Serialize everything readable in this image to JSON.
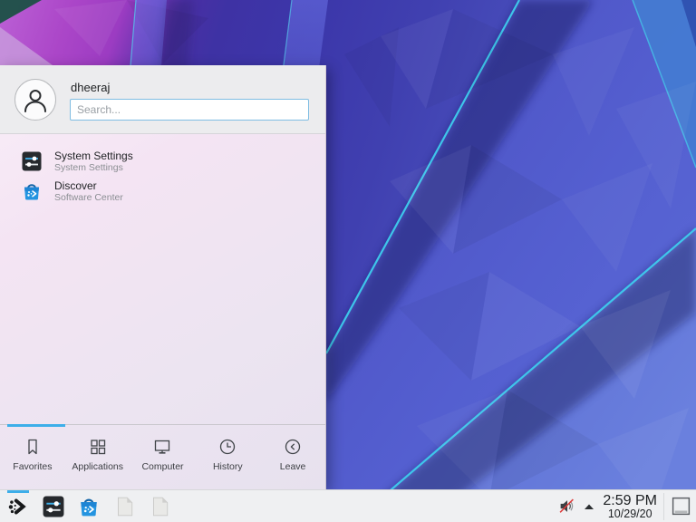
{
  "launcher": {
    "user_name": "dheeraj",
    "search_placeholder": "Search...",
    "items": [
      {
        "title": "System Settings",
        "subtitle": "System Settings",
        "icon": "system-settings-icon"
      },
      {
        "title": "Discover",
        "subtitle": "Software Center",
        "icon": "discover-icon"
      }
    ],
    "tabs": [
      {
        "label": "Favorites",
        "icon": "bookmark-icon",
        "active": true
      },
      {
        "label": "Applications",
        "icon": "app-grid-icon",
        "active": false
      },
      {
        "label": "Computer",
        "icon": "monitor-icon",
        "active": false
      },
      {
        "label": "History",
        "icon": "clock-icon",
        "active": false
      },
      {
        "label": "Leave",
        "icon": "leave-icon",
        "active": false
      }
    ],
    "active_tab": "Favorites"
  },
  "taskbar": {
    "pinned_apps": [
      "application-launcher",
      "system-settings",
      "discover",
      "document",
      "document"
    ],
    "active_app": "application-launcher",
    "tray": {
      "volume_state": "muted",
      "expander": "up-arrow"
    },
    "clock": {
      "time": "2:59 PM",
      "date": "10/29/20"
    }
  },
  "colors": {
    "accent": "#3daee9",
    "wallpaper_cyan_edge": "#3ecdee",
    "panel_bg": "#eff0f2",
    "menu_header_bg": "#ececee",
    "search_border": "#7fbde2"
  }
}
